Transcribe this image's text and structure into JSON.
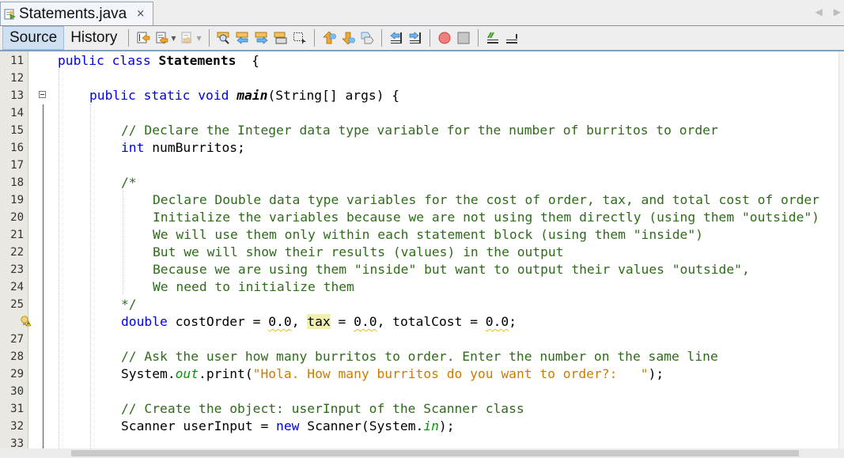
{
  "tab": {
    "file_name": "Statements.java",
    "close_glyph": "×",
    "icon": "java-file-icon"
  },
  "tab_nav": {
    "prev_glyph": "◀",
    "next_glyph": "▶"
  },
  "toolbar": {
    "source_label": "Source",
    "history_label": "History",
    "active_view": "Source",
    "icons": [
      "last-edit-icon",
      "back-icon",
      "forward-icon",
      "find-icon",
      "find-previous-icon",
      "find-next-icon",
      "toggle-highlight-icon",
      "rect-selection-icon",
      "previous-bookmark-icon",
      "next-bookmark-icon",
      "toggle-bookmark-icon",
      "shift-left-icon",
      "shift-right-icon",
      "start-macro-icon",
      "stop-macro-icon",
      "comment-icon",
      "uncomment-icon"
    ]
  },
  "editor": {
    "hint_line_icon": "warning-bulb-icon",
    "lines": [
      {
        "n": "11",
        "indent": 0,
        "tokens": [
          [
            "kw",
            "public class "
          ],
          [
            "bold",
            "Statements"
          ],
          [
            "",
            "  {"
          ]
        ]
      },
      {
        "n": "12",
        "indent": 0,
        "tokens": []
      },
      {
        "n": "13",
        "indent": 1,
        "tokens": [
          [
            "kw",
            "public static void "
          ],
          [
            "fn",
            "main"
          ],
          [
            "",
            "(String[] args) {"
          ]
        ]
      },
      {
        "n": "14",
        "indent": 0,
        "tokens": []
      },
      {
        "n": "15",
        "indent": 2,
        "tokens": [
          [
            "cm",
            "// Declare the Integer data type variable for the number of burritos to order"
          ]
        ]
      },
      {
        "n": "16",
        "indent": 2,
        "tokens": [
          [
            "kw",
            "int"
          ],
          [
            "",
            " numBurritos;"
          ]
        ]
      },
      {
        "n": "17",
        "indent": 0,
        "tokens": []
      },
      {
        "n": "18",
        "indent": 2,
        "tokens": [
          [
            "cm",
            "/*"
          ]
        ]
      },
      {
        "n": "19",
        "indent": 3,
        "tokens": [
          [
            "cm",
            "Declare Double data type variables for the cost of order, tax, and total cost of order"
          ]
        ]
      },
      {
        "n": "20",
        "indent": 3,
        "tokens": [
          [
            "cm",
            "Initialize the variables because we are not using them directly (using them \"outside\")"
          ]
        ]
      },
      {
        "n": "21",
        "indent": 3,
        "tokens": [
          [
            "cm",
            "We will use them only within each statement block (using them \"inside\")"
          ]
        ]
      },
      {
        "n": "22",
        "indent": 3,
        "tokens": [
          [
            "cm",
            "But we will show their results (values) in the output"
          ]
        ]
      },
      {
        "n": "23",
        "indent": 3,
        "tokens": [
          [
            "cm",
            "Because we are using them \"inside\" but want to output their values \"outside\","
          ]
        ]
      },
      {
        "n": "24",
        "indent": 3,
        "tokens": [
          [
            "cm",
            "We need to initialize them"
          ]
        ]
      },
      {
        "n": "25",
        "indent": 2,
        "tokens": [
          [
            "cm",
            "*/"
          ]
        ]
      },
      {
        "n": "",
        "indent": 2,
        "tokens": [
          [
            "kw",
            "double"
          ],
          [
            "",
            " costOrder = "
          ],
          [
            "wavy",
            "0.0"
          ],
          [
            "",
            ", "
          ],
          [
            "hl",
            "tax"
          ],
          [
            "",
            " = "
          ],
          [
            "wavy",
            "0.0"
          ],
          [
            "",
            ", totalCost = "
          ],
          [
            "wavy",
            "0.0"
          ],
          [
            "",
            ";"
          ]
        ]
      },
      {
        "n": "27",
        "indent": 0,
        "tokens": []
      },
      {
        "n": "28",
        "indent": 2,
        "tokens": [
          [
            "cm",
            "// Ask the user how many burritos to order. Enter the number on the same line"
          ]
        ]
      },
      {
        "n": "29",
        "indent": 2,
        "tokens": [
          [
            "",
            "System."
          ],
          [
            "ital",
            "out"
          ],
          [
            "",
            ".print("
          ],
          [
            "str",
            "\"Hola. How many burritos do you want to order?:   \""
          ],
          [
            "",
            ");"
          ]
        ]
      },
      {
        "n": "30",
        "indent": 0,
        "tokens": []
      },
      {
        "n": "31",
        "indent": 2,
        "tokens": [
          [
            "cm",
            "// Create the object: userInput of the Scanner class"
          ]
        ]
      },
      {
        "n": "32",
        "indent": 2,
        "tokens": [
          [
            "",
            "Scanner userInput = "
          ],
          [
            "kw",
            "new"
          ],
          [
            "",
            " Scanner(System."
          ],
          [
            "ital",
            "in"
          ],
          [
            "",
            ");"
          ]
        ]
      },
      {
        "n": "33",
        "indent": 0,
        "tokens": []
      }
    ]
  }
}
